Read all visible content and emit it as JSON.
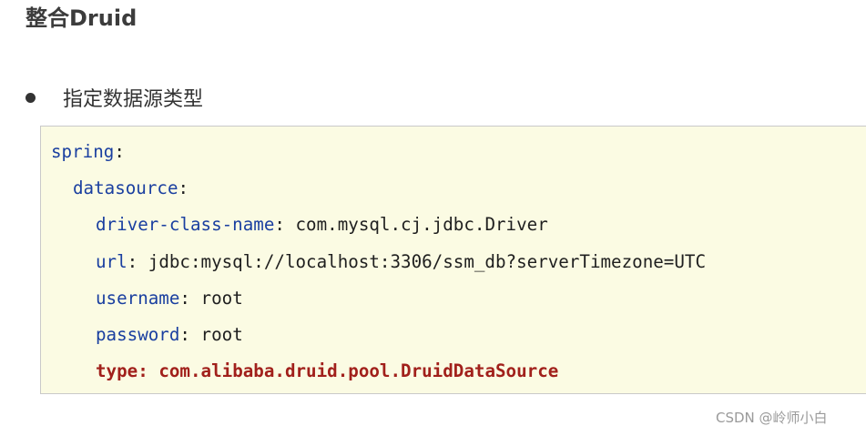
{
  "heading": {
    "title": "整合Druid"
  },
  "bullet": {
    "text": "指定数据源类型"
  },
  "code": {
    "lines": [
      {
        "key": "spring",
        "sep": ":",
        "value": ""
      },
      {
        "key": "datasource",
        "sep": ":",
        "value": ""
      },
      {
        "key": "driver-class-name",
        "sep": ":",
        "value": " com.mysql.cj.jdbc.Driver"
      },
      {
        "key": "url",
        "sep": ":",
        "value": " jdbc:mysql://localhost:3306/ssm_db?serverTimezone=UTC"
      },
      {
        "key": "username",
        "sep": ":",
        "value": " root"
      },
      {
        "key": "password",
        "sep": ":",
        "value": " root"
      },
      {
        "key": "type",
        "sep": ":",
        "value": " com.alibaba.druid.pool.DruidDataSource"
      }
    ]
  },
  "colors": {
    "yaml_key": "#1a3fa0",
    "highlight": "#a1201b",
    "code_background": "#fbfbe3"
  },
  "watermark": {
    "text": "CSDN @岭师小白"
  }
}
